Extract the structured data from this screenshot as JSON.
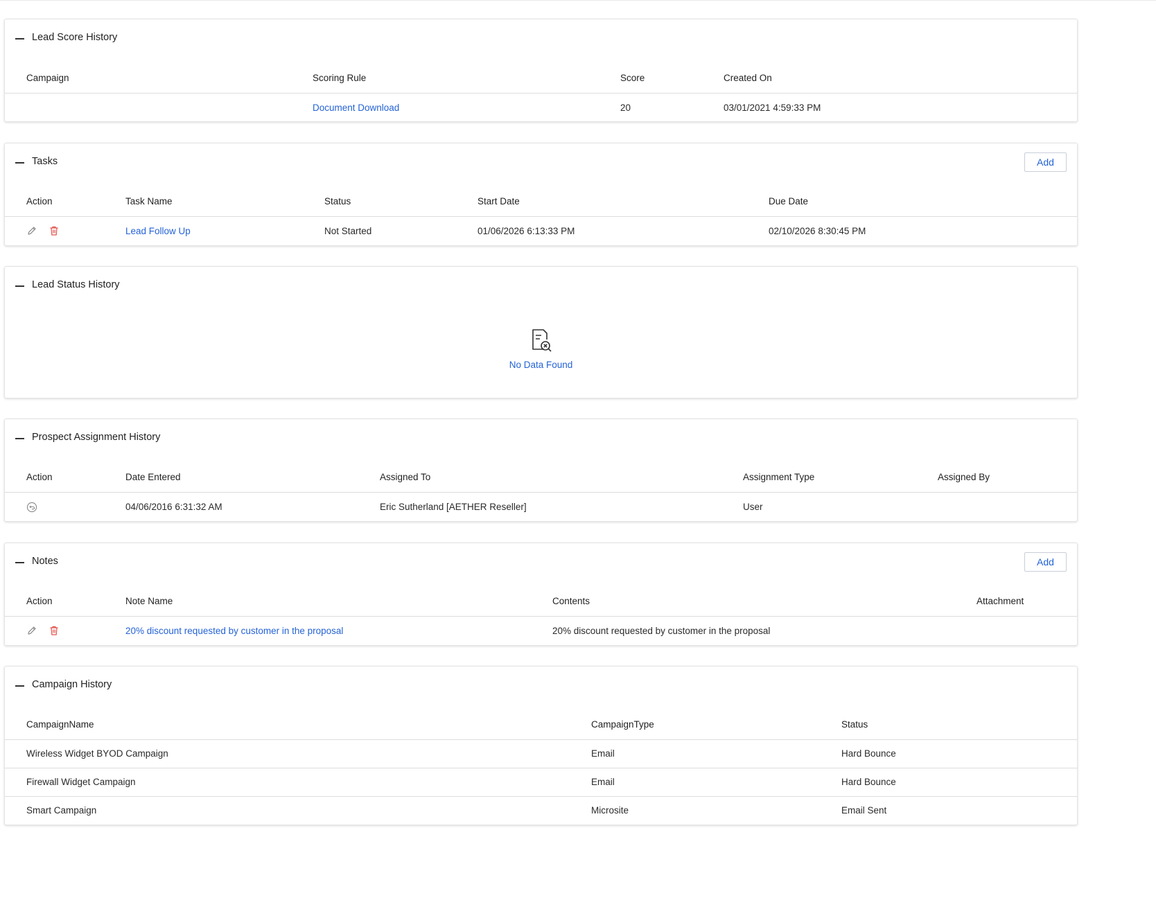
{
  "sections": {
    "lead_score": {
      "title": "Lead Score History",
      "columns": [
        "Campaign",
        "Scoring Rule",
        "Score",
        "Created On"
      ],
      "rows": [
        {
          "campaign": "",
          "scoring_rule": "Document Download",
          "score": "20",
          "created_on": "03/01/2021 4:59:33 PM"
        }
      ]
    },
    "tasks": {
      "title": "Tasks",
      "add_label": "Add",
      "columns": [
        "Action",
        "Task Name",
        "Status",
        "Start Date",
        "Due Date"
      ],
      "rows": [
        {
          "task_name": "Lead Follow Up",
          "status": "Not Started",
          "start_date": "01/06/2026 6:13:33 PM",
          "due_date": "02/10/2026 8:30:45 PM"
        }
      ]
    },
    "lead_status": {
      "title": "Lead Status History",
      "empty_text": "No Data Found"
    },
    "prospect": {
      "title": "Prospect Assignment History",
      "columns": [
        "Action",
        "Date Entered",
        "Assigned To",
        "Assignment Type",
        "Assigned By"
      ],
      "rows": [
        {
          "date_entered": "04/06/2016 6:31:32 AM",
          "assigned_to": "Eric Sutherland [AETHER Reseller]",
          "assignment_type": "User",
          "assigned_by": ""
        }
      ]
    },
    "notes": {
      "title": "Notes",
      "add_label": "Add",
      "columns": [
        "Action",
        "Note Name",
        "Contents",
        "Attachment"
      ],
      "rows": [
        {
          "note_name": "20% discount requested by customer in the proposal",
          "contents": "20% discount requested by customer in the proposal",
          "attachment": ""
        }
      ]
    },
    "campaign_history": {
      "title": "Campaign History",
      "columns": [
        "CampaignName",
        "CampaignType",
        "Status"
      ],
      "rows": [
        {
          "name": "Wireless Widget BYOD Campaign",
          "type": "Email",
          "status": "Hard Bounce"
        },
        {
          "name": "Firewall Widget Campaign",
          "type": "Email",
          "status": "Hard Bounce"
        },
        {
          "name": "Smart Campaign",
          "type": "Microsite",
          "status": "Email Sent"
        }
      ]
    }
  },
  "icons": {
    "collapse": "minus-icon",
    "edit": "pencil-icon",
    "delete": "trash-icon",
    "reassign": "undo-circle-icon",
    "empty": "document-x-icon"
  },
  "colors": {
    "link": "#2463d6",
    "delete": "#e0504a",
    "border": "#dcdcdc"
  }
}
